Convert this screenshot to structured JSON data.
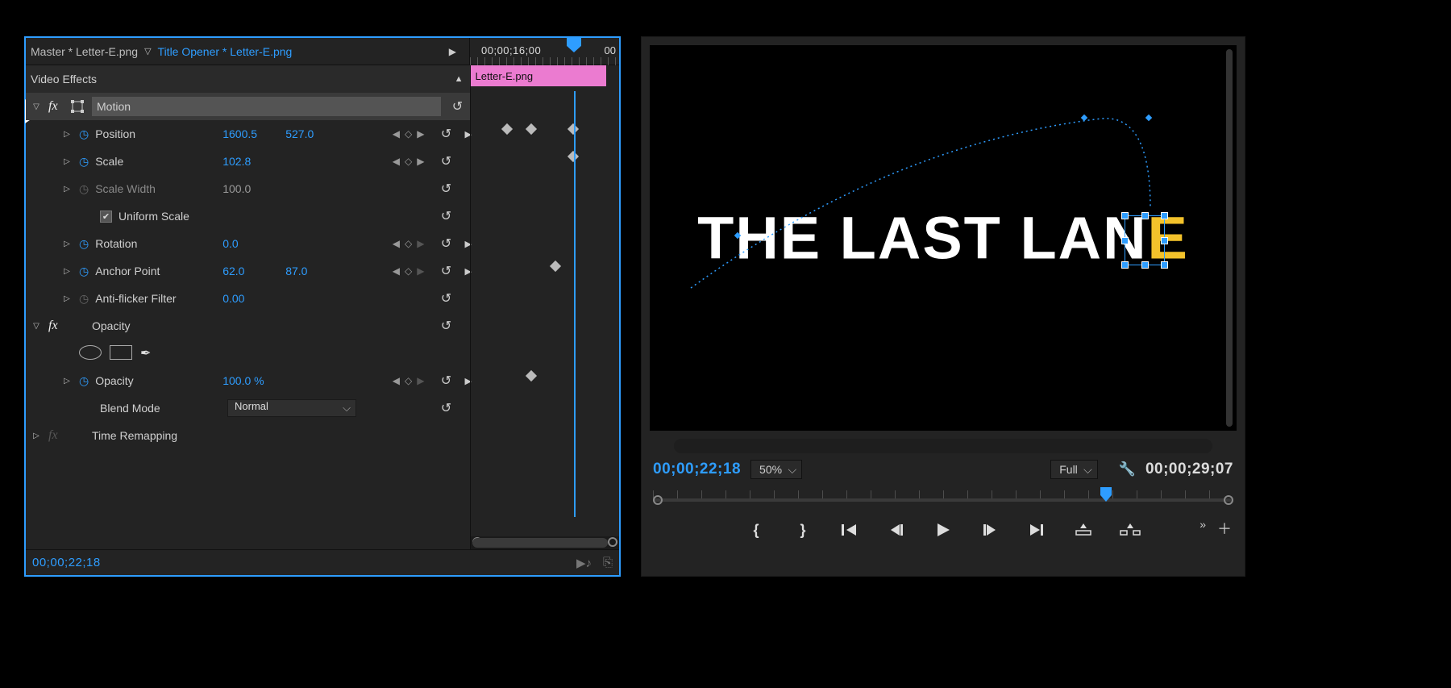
{
  "effectControls": {
    "masterLabel": "Master * Letter-E.png",
    "activeLabel": "Title Opener * Letter-E.png",
    "rulerTime": "00;00;16;00",
    "rulerEnd": "00",
    "clipName": "Letter-E.png",
    "sectionVideoEffects": "Video Effects",
    "footerTime": "00;00;22;18",
    "motion": {
      "label": "Motion",
      "position": {
        "label": "Position",
        "x": "1600.5",
        "y": "527.0"
      },
      "scale": {
        "label": "Scale",
        "value": "102.8"
      },
      "scaleWidth": {
        "label": "Scale Width",
        "value": "100.0"
      },
      "uniformScale": {
        "label": "Uniform Scale",
        "checked": true
      },
      "rotation": {
        "label": "Rotation",
        "value": "0.0"
      },
      "anchor": {
        "label": "Anchor Point",
        "x": "62.0",
        "y": "87.0"
      },
      "antiFlicker": {
        "label": "Anti-flicker Filter",
        "value": "0.00"
      }
    },
    "opacity": {
      "label": "Opacity",
      "value": {
        "label": "Opacity",
        "value": "100.0 %"
      },
      "blendMode": {
        "label": "Blend Mode",
        "value": "Normal"
      }
    },
    "timeRemap": {
      "label": "Time Remapping"
    }
  },
  "monitor": {
    "titleMain": "THE LAST LAN",
    "titleHot": "E",
    "leftTime": "00;00;22;18",
    "zoom": "50%",
    "quality": "Full",
    "rightTime": "00;00;29;07"
  },
  "colors": {
    "accent": "#2e9dff",
    "hot": "#f3c22b",
    "clip": "#eb7bd0"
  }
}
